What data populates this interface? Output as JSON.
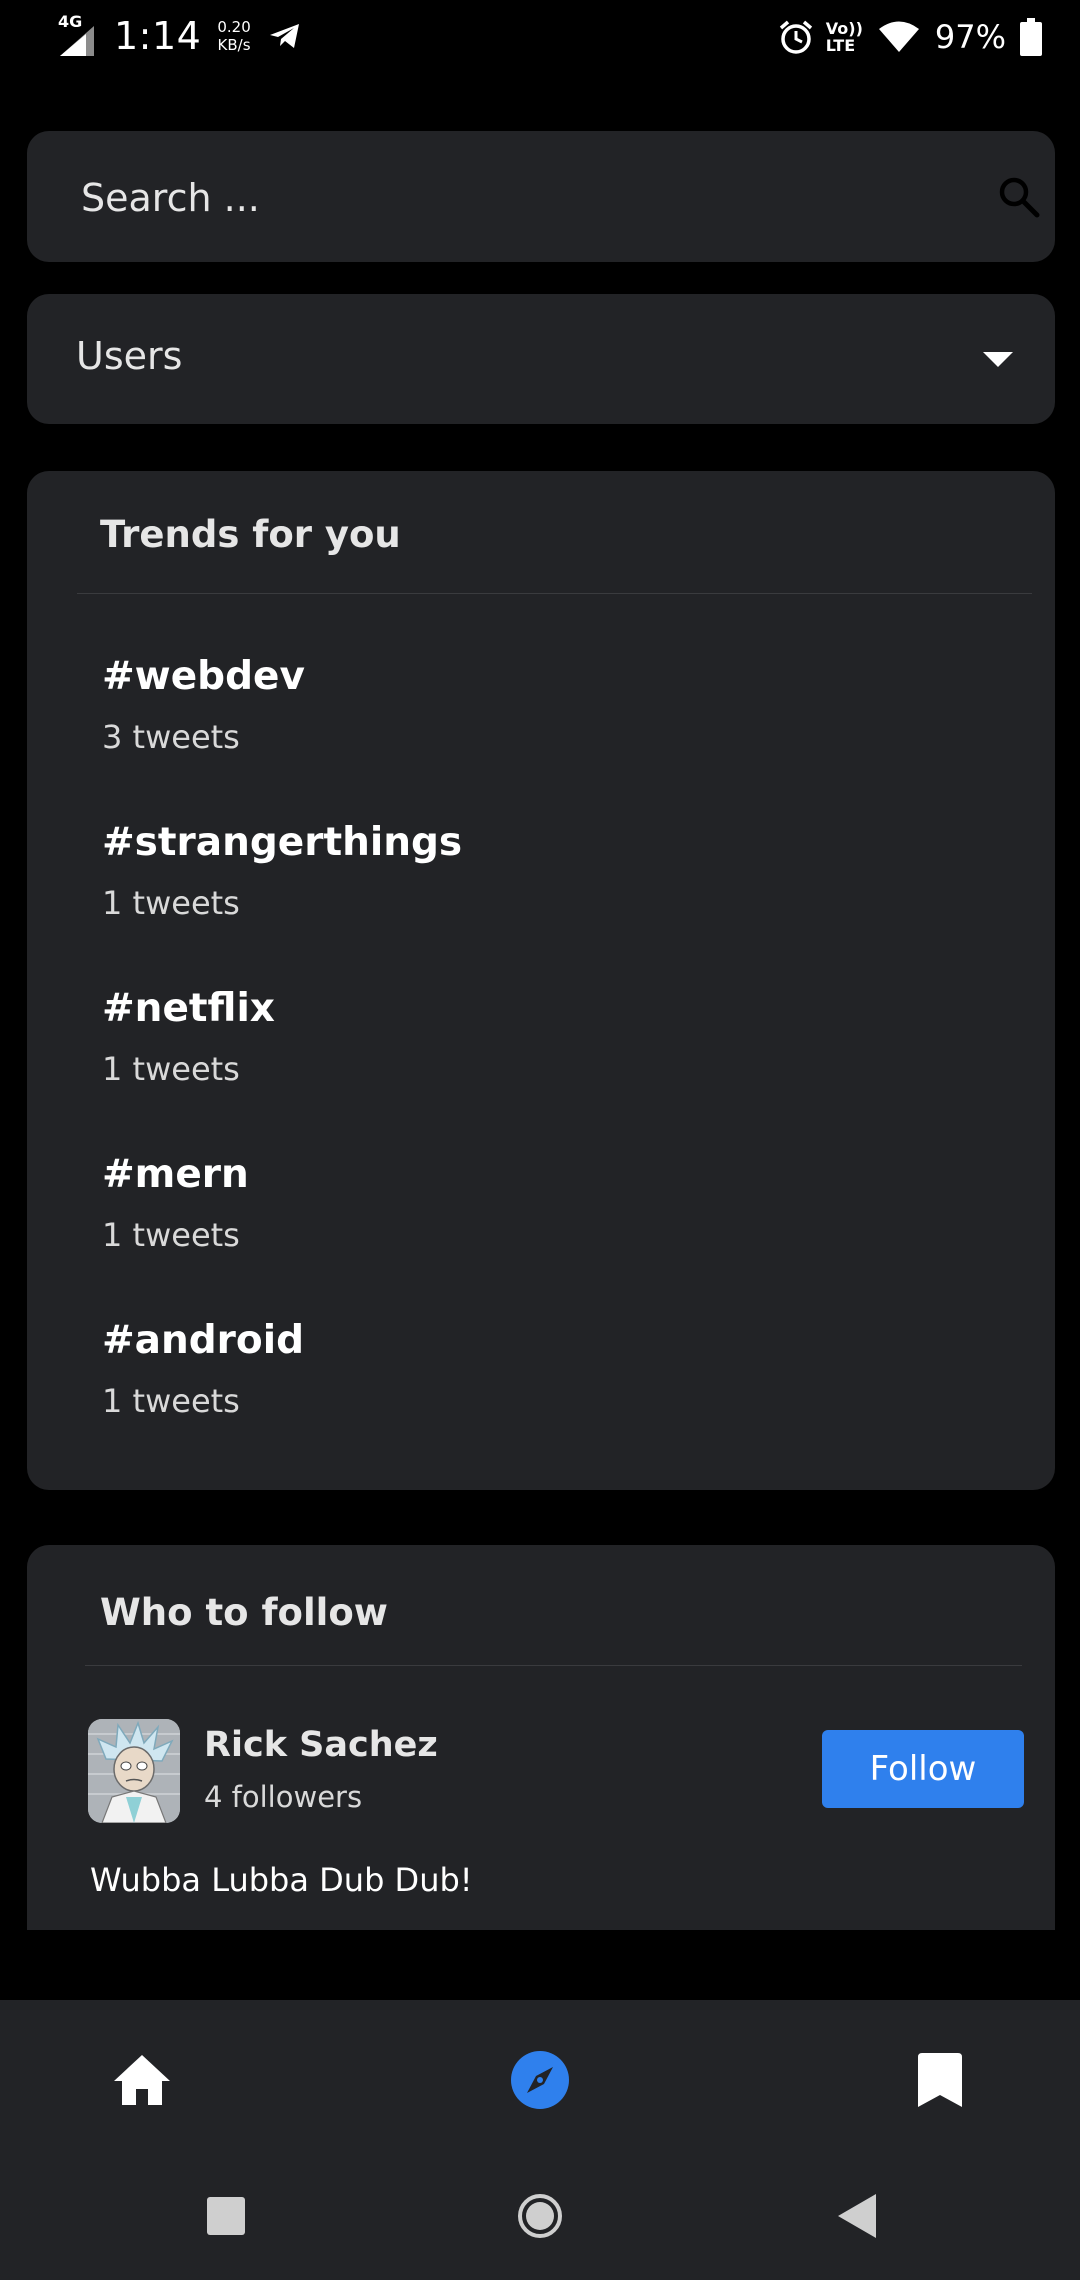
{
  "status_bar": {
    "network": "4G",
    "time": "1:14",
    "speed_value": "0.20",
    "speed_unit": "KB/s",
    "volte_top": "Vo))",
    "volte_bottom": "LTE",
    "battery": "97%",
    "icons": [
      "signal-icon",
      "telegram-icon",
      "alarm-icon",
      "wifi-icon",
      "battery-icon"
    ]
  },
  "search": {
    "placeholder": "Search ..."
  },
  "filter": {
    "selected": "Users"
  },
  "trends": {
    "title": "Trends for you",
    "items": [
      {
        "tag": "#webdev",
        "count": "3 tweets"
      },
      {
        "tag": "#strangerthings",
        "count": "1 tweets"
      },
      {
        "tag": "#netflix",
        "count": "1 tweets"
      },
      {
        "tag": "#mern",
        "count": "1 tweets"
      },
      {
        "tag": "#android",
        "count": "1 tweets"
      }
    ]
  },
  "who_to_follow": {
    "title": "Who to follow",
    "user": {
      "name": "Rick Sachez",
      "followers": "4 followers",
      "bio": "Wubba Lubba Dub Dub!",
      "follow_label": "Follow"
    }
  },
  "bottom_nav": {
    "items": [
      "home-icon",
      "explore-icon",
      "bookmark-icon"
    ],
    "active": "explore-icon",
    "accent": "#2f80ed"
  },
  "colors": {
    "background": "#000000",
    "card": "#222326",
    "accent": "#2f80ed"
  }
}
